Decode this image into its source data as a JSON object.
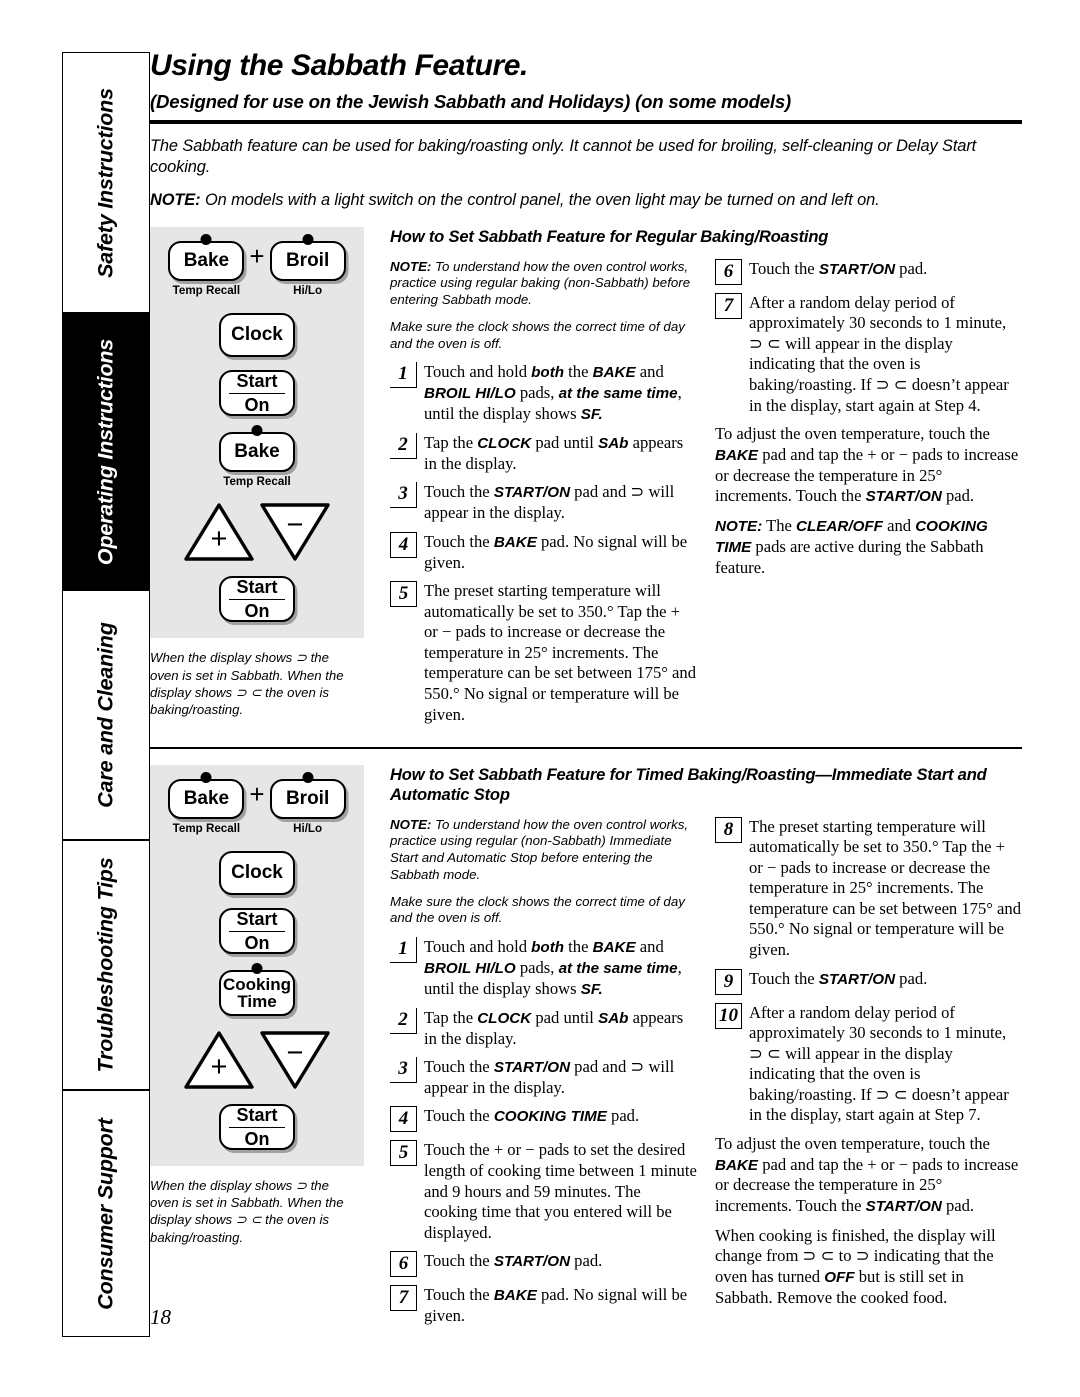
{
  "sidebar": {
    "tabs": [
      {
        "label": "Safety Instructions",
        "dark": false
      },
      {
        "label": "Operating Instructions",
        "dark": true
      },
      {
        "label": "Care and Cleaning",
        "dark": false
      },
      {
        "label": "Troubleshooting Tips",
        "dark": false
      },
      {
        "label": "Consumer Support",
        "dark": false
      }
    ]
  },
  "header": {
    "title": "Using the Sabbath Feature.",
    "subtitle": "(Designed for use on the Jewish Sabbath and Holidays) (on some models)",
    "intro": "The Sabbath feature can be used for baking/roasting only. It cannot be used for broiling, self-cleaning or Delay Start cooking.",
    "note_label": "NOTE:",
    "note_text": " On models with a light switch on the control panel, the oven light may be turned on and left on."
  },
  "section1": {
    "heading": "How to Set Sabbath Feature for Regular Baking/Roasting",
    "note_label": "NOTE:",
    "note_text": " To understand how the oven control works, practice using regular baking (non-Sabbath) before entering Sabbath mode.",
    "note2": "Make sure the clock shows the correct time of day and the oven is off.",
    "steps_left": [
      {
        "num": "1",
        "style": "under",
        "parts": [
          {
            "t": "Touch and hold ",
            "b": false
          },
          {
            "t": "both",
            "b": true
          },
          {
            "t": " the ",
            "b": false
          },
          {
            "t": "BAKE",
            "b": true
          },
          {
            "t": " and ",
            "b": false
          },
          {
            "t": "BROIL HI/LO",
            "b": true
          },
          {
            "t": " pads, ",
            "b": false
          },
          {
            "t": "at the same time",
            "b": true
          },
          {
            "t": ", until the display shows ",
            "b": false
          },
          {
            "t": "SF.",
            "b": true
          }
        ]
      },
      {
        "num": "2",
        "style": "under",
        "parts": [
          {
            "t": "Tap the ",
            "b": false
          },
          {
            "t": "CLOCK",
            "b": true
          },
          {
            "t": " pad until ",
            "b": false
          },
          {
            "t": "SAb",
            "b": true
          },
          {
            "t": " appears in the display.",
            "b": false
          }
        ]
      },
      {
        "num": "3",
        "style": "under",
        "parts": [
          {
            "t": "Touch the ",
            "b": false
          },
          {
            "t": "START/ON",
            "b": true
          },
          {
            "t": " pad and ⊃ will appear in the display.",
            "b": false
          }
        ]
      },
      {
        "num": "4",
        "style": "boxed",
        "parts": [
          {
            "t": "Touch the ",
            "b": false
          },
          {
            "t": "BAKE",
            "b": true
          },
          {
            "t": " pad. No signal will be given.",
            "b": false
          }
        ]
      },
      {
        "num": "5",
        "style": "boxed",
        "parts": [
          {
            "t": "The preset starting temperature will automatically be set to 350.° Tap the + or − pads to increase or decrease the temperature in 25° increments. The temperature can be set between 175° and 550.° No signal or temperature will be given.",
            "b": false
          }
        ]
      }
    ],
    "steps_right": [
      {
        "num": "6",
        "style": "boxed",
        "parts": [
          {
            "t": "Touch the ",
            "b": false
          },
          {
            "t": "START/ON",
            "b": true
          },
          {
            "t": " pad.",
            "b": false
          }
        ]
      },
      {
        "num": "7",
        "style": "boxed",
        "parts": [
          {
            "t": "After a random delay period of approximately 30 seconds to 1 minute, ⊃ ⊂ will appear in the display indicating that the oven is baking/roasting. If ⊃ ⊂ doesn’t appear in the display, start again at Step 4.",
            "b": false
          }
        ]
      }
    ],
    "para_adjust": [
      {
        "t": "To adjust the oven temperature, touch the ",
        "b": false
      },
      {
        "t": "BAKE",
        "b": true
      },
      {
        "t": " pad and tap the + or − pads to increase or decrease the temperature in 25° increments. Touch the ",
        "b": false
      },
      {
        "t": "START/ON",
        "b": true
      },
      {
        "t": " pad.",
        "b": false
      }
    ],
    "para_note": [
      {
        "t": "NOTE:",
        "b": true
      },
      {
        "t": " The ",
        "b": false
      },
      {
        "t": "CLEAR/OFF",
        "b": true
      },
      {
        "t": " and ",
        "b": false
      },
      {
        "t": "COOKING TIME",
        "b": true
      },
      {
        "t": " pads are active during the Sabbath feature.",
        "b": false
      }
    ],
    "caption": "When the display shows ⊃ the oven is set in Sabbath. When the display shows ⊃ ⊂  the oven is baking/roasting.",
    "panel": {
      "bake_label": "Bake",
      "bake_sub": "Temp Recall",
      "plus_sign": "+",
      "broil_label": "Broil",
      "broil_sub": "Hi/Lo",
      "clock_label": "Clock",
      "start_top": "Start",
      "start_bottom": "On",
      "third_key_label": "Bake",
      "third_key_sub": "Temp Recall",
      "tri_plus": "+",
      "tri_minus": "−"
    }
  },
  "section2": {
    "heading": "How to Set Sabbath Feature for Timed Baking/Roasting—Immediate Start and Automatic Stop",
    "note_label": "NOTE:",
    "note_text": " To understand how the oven control works, practice using regular (non-Sabbath) Immediate Start and Automatic Stop before entering the Sabbath mode.",
    "note2": "Make sure the clock shows the correct time of day and the oven is off.",
    "steps_left": [
      {
        "num": "1",
        "style": "under",
        "parts": [
          {
            "t": "Touch and hold ",
            "b": false
          },
          {
            "t": "both",
            "b": true
          },
          {
            "t": " the ",
            "b": false
          },
          {
            "t": "BAKE",
            "b": true
          },
          {
            "t": " and ",
            "b": false
          },
          {
            "t": "BROIL HI/LO",
            "b": true
          },
          {
            "t": " pads, ",
            "b": false
          },
          {
            "t": "at the same time",
            "b": true
          },
          {
            "t": ", until the display shows ",
            "b": false
          },
          {
            "t": "SF.",
            "b": true
          }
        ]
      },
      {
        "num": "2",
        "style": "under",
        "parts": [
          {
            "t": "Tap the ",
            "b": false
          },
          {
            "t": "CLOCK",
            "b": true
          },
          {
            "t": " pad until ",
            "b": false
          },
          {
            "t": "SAb",
            "b": true
          },
          {
            "t": " appears in the display.",
            "b": false
          }
        ]
      },
      {
        "num": "3",
        "style": "under",
        "parts": [
          {
            "t": "Touch the ",
            "b": false
          },
          {
            "t": "START/ON",
            "b": true
          },
          {
            "t": " pad and ⊃ will appear in the display.",
            "b": false
          }
        ]
      },
      {
        "num": "4",
        "style": "boxed",
        "parts": [
          {
            "t": "Touch the ",
            "b": false
          },
          {
            "t": "COOKING TIME",
            "b": true
          },
          {
            "t": " pad.",
            "b": false
          }
        ]
      },
      {
        "num": "5",
        "style": "boxed",
        "parts": [
          {
            "t": "Touch the + or − pads to set the desired length of cooking time between 1 minute and 9 hours and 59 minutes. The cooking time that you entered will be displayed.",
            "b": false
          }
        ]
      },
      {
        "num": "6",
        "style": "boxed",
        "parts": [
          {
            "t": "Touch the ",
            "b": false
          },
          {
            "t": "START/ON",
            "b": true
          },
          {
            "t": " pad.",
            "b": false
          }
        ]
      },
      {
        "num": "7",
        "style": "boxed",
        "parts": [
          {
            "t": "Touch the ",
            "b": false
          },
          {
            "t": "BAKE",
            "b": true
          },
          {
            "t": " pad. No signal will be given.",
            "b": false
          }
        ]
      }
    ],
    "steps_right": [
      {
        "num": "8",
        "style": "boxed",
        "parts": [
          {
            "t": "The preset starting temperature will automatically be set to 350.° Tap the + or − pads to increase or decrease the temperature in 25° increments. The temperature can be set between 175° and 550.° No signal or temperature will be given.",
            "b": false
          }
        ]
      },
      {
        "num": "9",
        "style": "boxed",
        "parts": [
          {
            "t": "Touch the ",
            "b": false
          },
          {
            "t": "START/ON",
            "b": true
          },
          {
            "t": " pad.",
            "b": false
          }
        ]
      },
      {
        "num": "10",
        "style": "boxed",
        "parts": [
          {
            "t": "After a random delay period of approximately 30 seconds to 1 minute, ⊃ ⊂ will appear in the display indicating that the oven is baking/roasting. If ⊃ ⊂ doesn’t appear in the display, start again at Step 7.",
            "b": false
          }
        ]
      }
    ],
    "para_adjust": [
      {
        "t": "To adjust the oven temperature, touch the ",
        "b": false
      },
      {
        "t": "BAKE",
        "b": true
      },
      {
        "t": " pad and tap the + or − pads to increase or decrease the temperature in 25° increments. Touch the ",
        "b": false
      },
      {
        "t": "START/ON",
        "b": true
      },
      {
        "t": " pad.",
        "b": false
      }
    ],
    "para_finish": [
      {
        "t": "When cooking is finished, the display will change from ⊃ ⊂ to ⊃ indicating that the oven has turned ",
        "b": false
      },
      {
        "t": "OFF",
        "b": true
      },
      {
        "t": " but is still set in Sabbath. Remove the cooked food.",
        "b": false
      }
    ],
    "caption": "When the display shows ⊃ the oven is set in Sabbath. When the display shows ⊃ ⊂  the oven is baking/roasting.",
    "panel": {
      "bake_label": "Bake",
      "bake_sub": "Temp Recall",
      "plus_sign": "+",
      "broil_label": "Broil",
      "broil_sub": "Hi/Lo",
      "clock_label": "Clock",
      "start_top": "Start",
      "start_bottom": "On",
      "third_key_label_line1": "Cooking",
      "third_key_label_line2": "Time",
      "tri_plus": "+",
      "tri_minus": "−"
    }
  },
  "footer": {
    "page_number": "18"
  }
}
